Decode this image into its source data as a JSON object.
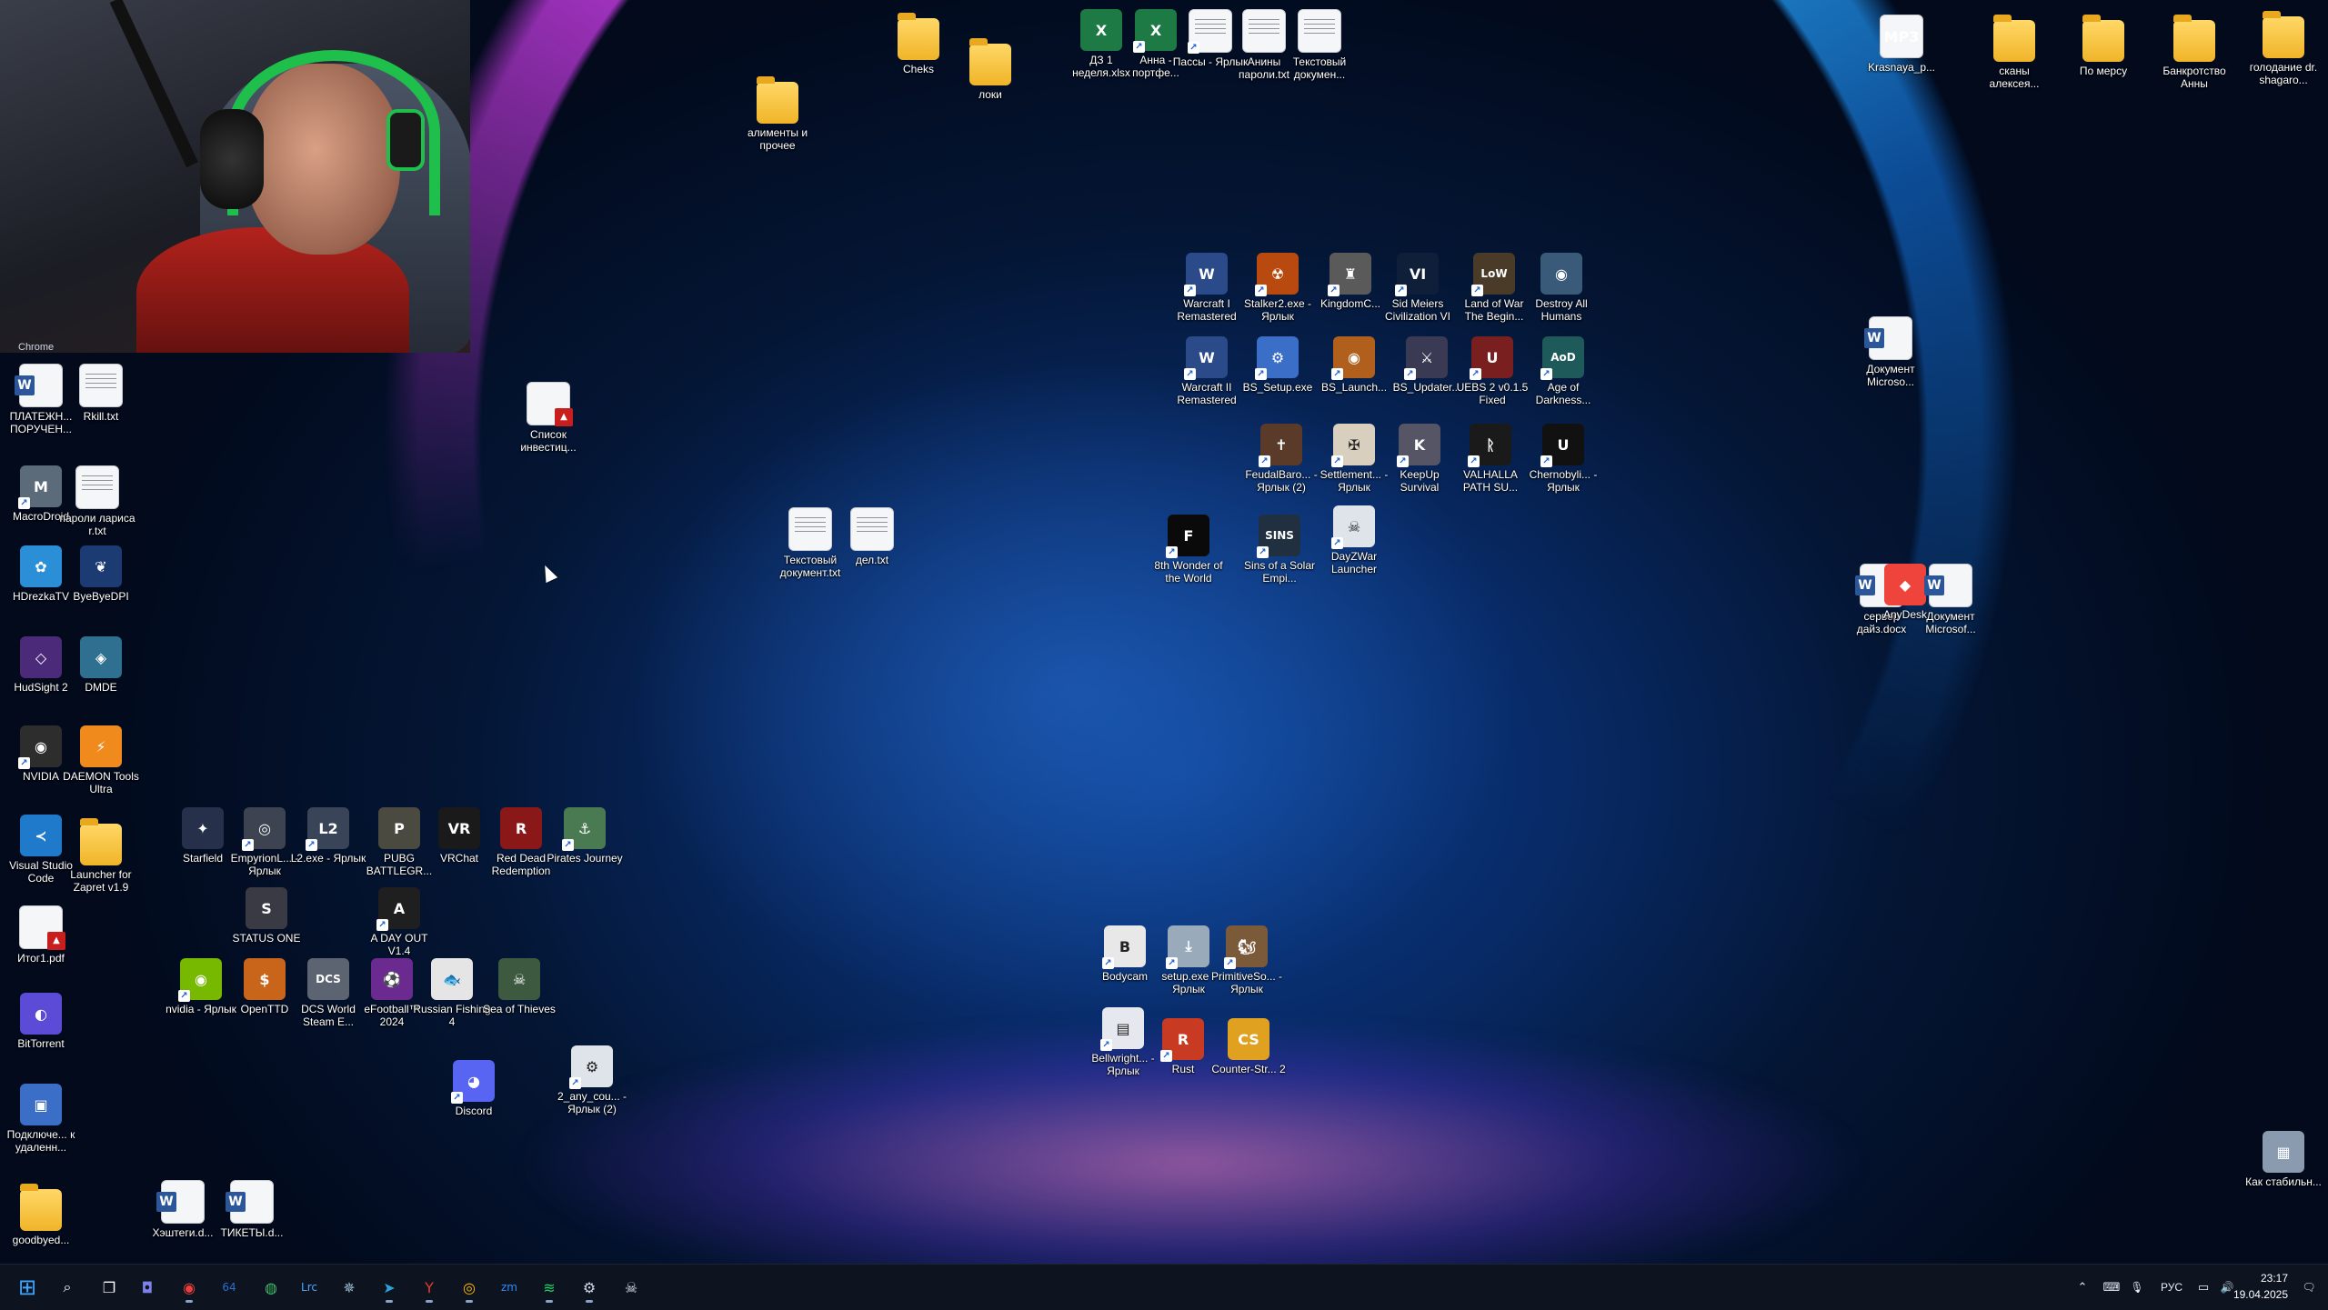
{
  "desktop": {
    "webcam_partial_label": "Chrome",
    "icons": [
      {
        "label": "Cheks",
        "kind": "folder",
        "icon": "folder-icon",
        "shortcut": false
      },
      {
        "label": "локи",
        "kind": "folder",
        "icon": "folder-icon",
        "shortcut": false
      },
      {
        "label": "алименты и прочее",
        "kind": "folder",
        "icon": "folder-icon",
        "shortcut": false
      },
      {
        "label": "ДЗ 1 неделя.xlsx",
        "kind": "xls",
        "icon": "excel-file-icon",
        "shortcut": false
      },
      {
        "label": "Анна - портфе...",
        "kind": "xls",
        "icon": "excel-file-icon",
        "shortcut": true
      },
      {
        "label": "Пассы - Ярлык",
        "kind": "txt",
        "icon": "text-file-icon",
        "shortcut": true
      },
      {
        "label": "Анины пароли.txt",
        "kind": "txt",
        "icon": "text-file-icon",
        "shortcut": false
      },
      {
        "label": "Текстовый докумен...",
        "kind": "txt",
        "icon": "text-file-icon",
        "shortcut": false
      },
      {
        "label": "Krasnaya_p...",
        "kind": "mp3",
        "icon": "mp3-file-icon",
        "shortcut": false
      },
      {
        "label": "сканы алексея...",
        "kind": "folder",
        "icon": "folder-icon",
        "shortcut": false
      },
      {
        "label": "По мерсу",
        "kind": "folder",
        "icon": "folder-icon",
        "shortcut": false
      },
      {
        "label": "Банкротство Анны",
        "kind": "folder",
        "icon": "folder-icon",
        "shortcut": false
      },
      {
        "label": "голодание dr. shagaro...",
        "kind": "folder",
        "icon": "folder-icon",
        "shortcut": false
      },
      {
        "label": "ПЛАТЕЖН... ПОРУЧЕН...",
        "kind": "word",
        "icon": "word-file-icon",
        "shortcut": false
      },
      {
        "label": "Rkill.txt",
        "kind": "txt",
        "icon": "text-file-icon",
        "shortcut": false
      },
      {
        "label": "Список инвестиц...",
        "kind": "pdf",
        "icon": "pdf-file-icon",
        "shortcut": false
      },
      {
        "label": "MacroDroid",
        "kind": "app",
        "icon": "macrodroid-icon",
        "color": "#5b6b7a",
        "glyph": "M",
        "shortcut": true
      },
      {
        "label": "пароли лариса r.txt",
        "kind": "txt",
        "icon": "text-file-icon",
        "shortcut": false
      },
      {
        "label": "HDrezkaTV",
        "kind": "app",
        "icon": "hdrezka-icon",
        "color": "#2a8fd6",
        "glyph": "✿",
        "shortcut": false
      },
      {
        "label": "ByeByeDPI",
        "kind": "app",
        "icon": "byebyedpi-icon",
        "color": "#1c3b73",
        "glyph": "❦",
        "shortcut": false
      },
      {
        "label": "HudSight 2",
        "kind": "app",
        "icon": "hudsight-icon",
        "color": "#4b2a7a",
        "glyph": "◇",
        "shortcut": false
      },
      {
        "label": "DMDE",
        "kind": "app",
        "icon": "dmde-icon",
        "color": "#2f6f8f",
        "glyph": "◈",
        "shortcut": false
      },
      {
        "label": "NVIDIA",
        "kind": "app",
        "icon": "nvidia-icon",
        "color": "#2d2d2d",
        "glyph": "◉",
        "shortcut": true
      },
      {
        "label": "DAEMON Tools Ultra",
        "kind": "app",
        "icon": "daemon-tools-icon",
        "color": "#f08a1c",
        "glyph": "⚡",
        "shortcut": false
      },
      {
        "label": "Visual Studio Code",
        "kind": "app",
        "icon": "vscode-icon",
        "color": "#1f7acc",
        "glyph": "≺",
        "shortcut": false
      },
      {
        "label": "Launcher for Zapret v1.9",
        "kind": "folder",
        "icon": "folder-icon",
        "shortcut": false
      },
      {
        "label": "Итог1.pdf",
        "kind": "pdf",
        "icon": "pdf-file-icon",
        "shortcut": false
      },
      {
        "label": "BitTorrent",
        "kind": "app",
        "icon": "bittorrent-icon",
        "color": "#5c4bd6",
        "glyph": "◐",
        "shortcut": false
      },
      {
        "label": "Подключе... к удаленн...",
        "kind": "app",
        "icon": "remote-desktop-icon",
        "color": "#3b6fc7",
        "glyph": "▣",
        "shortcut": false
      },
      {
        "label": "goodbyed...",
        "kind": "folder",
        "icon": "folder-icon",
        "shortcut": false
      },
      {
        "label": "Хэштеги.d...",
        "kind": "word",
        "icon": "word-file-icon",
        "shortcut": false
      },
      {
        "label": "ТИКЕТЫ.d...",
        "kind": "word",
        "icon": "word-file-icon",
        "shortcut": false
      },
      {
        "label": "Starfield",
        "kind": "app",
        "icon": "starfield-icon",
        "color": "#26304a",
        "glyph": "✦",
        "shortcut": false
      },
      {
        "label": "EmpyrionL... - Ярлык",
        "kind": "app",
        "icon": "empyrion-icon",
        "color": "#3d4350",
        "glyph": "◎",
        "shortcut": true
      },
      {
        "label": "L2.exe - Ярлык",
        "kind": "app",
        "icon": "lineage2-icon",
        "color": "#3a4458",
        "glyph": "L2",
        "shortcut": true
      },
      {
        "label": "PUBG BATTLEGR...",
        "kind": "app",
        "icon": "pubg-icon",
        "color": "#4a4a40",
        "glyph": "P",
        "shortcut": false
      },
      {
        "label": "VRChat",
        "kind": "app",
        "icon": "vrchat-icon",
        "color": "#1a1a1a",
        "glyph": "VR",
        "shortcut": false
      },
      {
        "label": "Red Dead Redemption",
        "kind": "app",
        "icon": "red-dead-icon",
        "color": "#8a1818",
        "glyph": "R",
        "shortcut": false
      },
      {
        "label": "Pirates Journey",
        "kind": "app",
        "icon": "pirates-journey-icon",
        "color": "#4a7a52",
        "glyph": "⚓",
        "shortcut": true
      },
      {
        "label": "STATUS ONE",
        "kind": "app",
        "icon": "status-one-icon",
        "color": "#3a3a44",
        "glyph": "S",
        "shortcut": false
      },
      {
        "label": "A DAY OUT V1.4",
        "kind": "app",
        "icon": "a-day-out-icon",
        "color": "#1f1f1f",
        "glyph": "A",
        "shortcut": true
      },
      {
        "label": "nvidia - Ярлык",
        "kind": "app",
        "icon": "nvidia-icon",
        "color": "#76b900",
        "glyph": "◉",
        "shortcut": true
      },
      {
        "label": "OpenTTD",
        "kind": "app",
        "icon": "openttd-icon",
        "color": "#c8651b",
        "glyph": "$",
        "shortcut": false
      },
      {
        "label": "DCS World Steam E...",
        "kind": "app",
        "icon": "dcs-world-icon",
        "color": "#5b6470",
        "glyph": "DCS",
        "shortcut": false
      },
      {
        "label": "eFootball™ 2024",
        "kind": "app",
        "icon": "efootball-icon",
        "color": "#6a2a90",
        "glyph": "⚽",
        "shortcut": false
      },
      {
        "label": "Russian Fishing 4",
        "kind": "app",
        "icon": "russian-fishing-icon",
        "color": "#e5e5e5",
        "glyph": "🐟",
        "shortcut": false
      },
      {
        "label": "Sea of Thieves",
        "kind": "app",
        "icon": "sea-of-thieves-icon",
        "color": "#3d5a40",
        "glyph": "☠",
        "shortcut": false
      },
      {
        "label": "Discord",
        "kind": "app",
        "icon": "discord-icon",
        "color": "#5865f2",
        "glyph": "◕",
        "shortcut": true
      },
      {
        "label": "2_any_cou... - Ярлык (2)",
        "kind": "app",
        "icon": "settings-shortcut-icon",
        "color": "#dfe3ea",
        "glyph": "⚙",
        "shortcut": true
      },
      {
        "label": "Текстовый документ.txt",
        "kind": "txt",
        "icon": "text-file-icon",
        "shortcut": false
      },
      {
        "label": "дел.txt",
        "kind": "txt",
        "icon": "text-file-icon",
        "shortcut": false
      },
      {
        "label": "Warcraft I Remastered",
        "kind": "app",
        "icon": "warcraft-icon",
        "color": "#2a4a8a",
        "glyph": "W",
        "shortcut": true
      },
      {
        "label": "Stalker2.exe - Ярлык",
        "kind": "app",
        "icon": "stalker2-icon",
        "color": "#b84a10",
        "glyph": "☢",
        "shortcut": true
      },
      {
        "label": "KingdomC...",
        "kind": "app",
        "icon": "kingdom-come-icon",
        "color": "#5a5a5a",
        "glyph": "♜",
        "shortcut": true
      },
      {
        "label": "Sid Meiers Civilization VI",
        "kind": "app",
        "icon": "civilization-icon",
        "color": "#0f1f3a",
        "glyph": "VI",
        "shortcut": true
      },
      {
        "label": "Land of War The Begin...",
        "kind": "app",
        "icon": "land-of-war-icon",
        "color": "#4a3a28",
        "glyph": "LoW",
        "shortcut": true
      },
      {
        "label": "Destroy All Humans",
        "kind": "app",
        "icon": "destroy-all-humans-icon",
        "color": "#3a5a7a",
        "glyph": "◉",
        "shortcut": false
      },
      {
        "label": "Warcraft II Remastered",
        "kind": "app",
        "icon": "warcraft-icon",
        "color": "#2a4a8a",
        "glyph": "W",
        "shortcut": true
      },
      {
        "label": "BS_Setup.exe",
        "kind": "app",
        "icon": "bs-setup-icon",
        "color": "#3b6fc7",
        "glyph": "⚙",
        "shortcut": true
      },
      {
        "label": "BS_Launch...",
        "kind": "app",
        "icon": "bs-launcher-icon",
        "color": "#b0601c",
        "glyph": "◉",
        "shortcut": true
      },
      {
        "label": "BS_Updater...",
        "kind": "app",
        "icon": "bs-updater-icon",
        "color": "#3a3a55",
        "glyph": "⚔",
        "shortcut": true
      },
      {
        "label": "UEBS 2 v0.1.5 Fixed",
        "kind": "app",
        "icon": "uebs2-icon",
        "color": "#7a1f1f",
        "glyph": "U",
        "shortcut": true
      },
      {
        "label": "Age of Darkness...",
        "kind": "app",
        "icon": "age-of-darkness-icon",
        "color": "#1f5a5a",
        "glyph": "AoD",
        "shortcut": true
      },
      {
        "label": "FeudalBaro... - Ярлык (2)",
        "kind": "app",
        "icon": "feudal-baron-icon",
        "color": "#5a3a28",
        "glyph": "✝",
        "shortcut": true
      },
      {
        "label": "Settlement... - Ярлык",
        "kind": "app",
        "icon": "settlement-icon",
        "color": "#d8cfbf",
        "glyph": "✠",
        "shortcut": true
      },
      {
        "label": "KeepUp Survival",
        "kind": "app",
        "icon": "keepup-survival-icon",
        "color": "#556",
        "glyph": "K",
        "shortcut": true
      },
      {
        "label": "VALHALLA PATH SU...",
        "kind": "app",
        "icon": "valhalla-icon",
        "color": "#1a1a1a",
        "glyph": "ᚱ",
        "shortcut": true
      },
      {
        "label": "Chernobyli... - Ярлык",
        "kind": "app",
        "icon": "unreal-engine-icon",
        "color": "#111",
        "glyph": "U",
        "shortcut": true
      },
      {
        "label": "8th Wonder of the World",
        "kind": "app",
        "icon": "8th-wonder-icon",
        "color": "#0a0a0a",
        "glyph": "F",
        "shortcut": true
      },
      {
        "label": "Sins of a Solar Empi...",
        "kind": "app",
        "icon": "sins-solar-empire-icon",
        "color": "#203040",
        "glyph": "SINS",
        "shortcut": true
      },
      {
        "label": "DayZWar Launcher",
        "kind": "app",
        "icon": "dayzwar-icon",
        "color": "#dfe3ea",
        "glyph": "☠",
        "shortcut": true
      },
      {
        "label": "Документ Microso...",
        "kind": "word",
        "icon": "word-file-icon",
        "shortcut": false
      },
      {
        "label": "сервер дайз.docx",
        "kind": "word",
        "icon": "word-file-icon",
        "shortcut": false
      },
      {
        "label": "AnyDesk",
        "kind": "app",
        "icon": "anydesk-icon",
        "color": "#ef443b",
        "glyph": "◆",
        "shortcut": false
      },
      {
        "label": "Документ Microsof...",
        "kind": "word",
        "icon": "word-file-icon",
        "shortcut": false
      },
      {
        "label": "Bodycam",
        "kind": "app",
        "icon": "bodycam-icon",
        "color": "#e8e8e8",
        "glyph": "B",
        "shortcut": true
      },
      {
        "label": "setup.exe - Ярлык",
        "kind": "app",
        "icon": "setup-exe-icon",
        "color": "#9ab",
        "glyph": "⤓",
        "shortcut": true
      },
      {
        "label": "PrimitiveSo... - Ярлык",
        "kind": "app",
        "icon": "primitive-society-icon",
        "color": "#7a5a38",
        "glyph": "🐿",
        "shortcut": true
      },
      {
        "label": "Bellwright... - Ярлык",
        "kind": "app",
        "icon": "bellwright-icon",
        "color": "#e5e8ee",
        "glyph": "▤",
        "shortcut": true
      },
      {
        "label": "Rust",
        "kind": "app",
        "icon": "rust-icon",
        "color": "#c83a22",
        "glyph": "R",
        "shortcut": true
      },
      {
        "label": "Counter-Str... 2",
        "kind": "app",
        "icon": "counter-strike-icon",
        "color": "#e0a020",
        "glyph": "CS",
        "shortcut": false
      },
      {
        "label": "Как стабильн...",
        "kind": "app",
        "icon": "image-file-icon",
        "color": "#8a9bb0",
        "glyph": "▦",
        "shortcut": false
      }
    ]
  },
  "taskbar": {
    "items": [
      {
        "name": "start-button",
        "icon": "windows-logo-icon",
        "glyph": "⊞",
        "color": "#3fa7ff",
        "running": false
      },
      {
        "name": "search-button",
        "icon": "search-icon",
        "glyph": "⌕",
        "color": "#ffffff",
        "running": false
      },
      {
        "name": "task-view-button",
        "icon": "task-view-icon",
        "glyph": "❐",
        "color": "#ffffff",
        "running": false
      },
      {
        "name": "taskbar-teams",
        "icon": "teams-chat-icon",
        "glyph": "◘",
        "color": "#7b83eb",
        "running": false
      },
      {
        "name": "taskbar-obs",
        "icon": "obs-record-icon",
        "glyph": "◉",
        "color": "#e64040",
        "running": true
      },
      {
        "name": "taskbar-64",
        "icon": "aida64-icon",
        "glyph": "64",
        "color": "#2a6fd1",
        "running": false
      },
      {
        "name": "taskbar-edge",
        "icon": "browser-icon",
        "glyph": "◍",
        "color": "#3fbf6a",
        "running": false
      },
      {
        "name": "taskbar-lrc",
        "icon": "lrc-icon",
        "glyph": "Lrc",
        "color": "#4aa8ff",
        "running": false
      },
      {
        "name": "taskbar-gear-app",
        "icon": "gear-app-icon",
        "glyph": "✵",
        "color": "#9bc",
        "running": false
      },
      {
        "name": "taskbar-telegram",
        "icon": "telegram-icon",
        "glyph": "➤",
        "color": "#2aa3dd",
        "running": true
      },
      {
        "name": "taskbar-yandex",
        "icon": "yandex-browser-icon",
        "glyph": "Y",
        "color": "#e63b2e",
        "running": true
      },
      {
        "name": "taskbar-chrome",
        "icon": "chrome-icon",
        "glyph": "◎",
        "color": "#fbbc05",
        "running": true
      },
      {
        "name": "taskbar-zoom",
        "icon": "zoom-icon",
        "glyph": "zm",
        "color": "#2d8cff",
        "running": false
      },
      {
        "name": "taskbar-spotify",
        "icon": "spotify-icon",
        "glyph": "≋",
        "color": "#1ed760",
        "running": true
      },
      {
        "name": "taskbar-settings",
        "icon": "settings-gear-icon",
        "glyph": "⚙",
        "color": "#cfd6e6",
        "running": true
      },
      {
        "name": "taskbar-game-launcher",
        "icon": "game-launcher-icon",
        "glyph": "☠",
        "color": "#dfe3ea",
        "running": false
      }
    ],
    "tray": {
      "chevron": "⌃",
      "keyboard": "⌨",
      "mic": "🎙",
      "language": "РУС",
      "network": "▭",
      "volume": "🔊",
      "time": "23:17",
      "date": "19.04.2025",
      "notification": "🗨"
    }
  }
}
